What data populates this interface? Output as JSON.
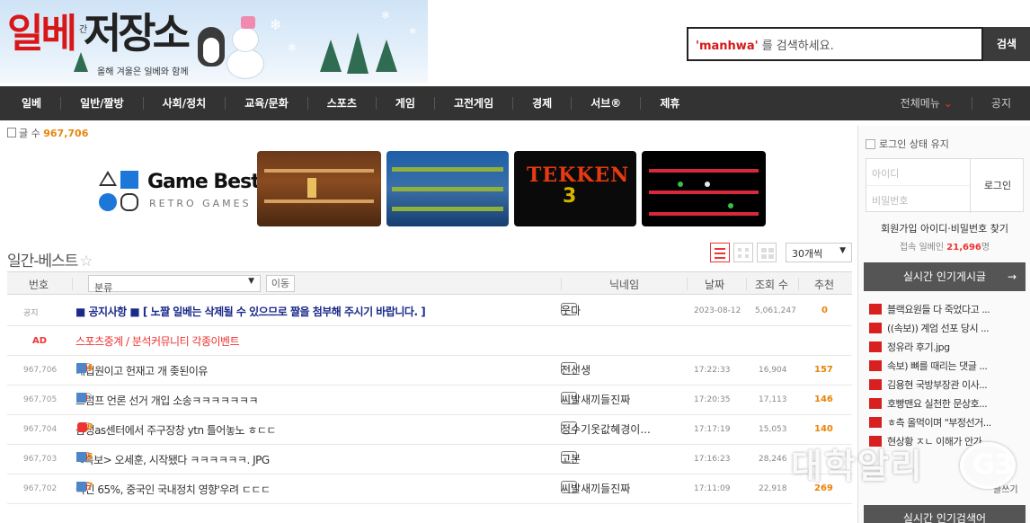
{
  "header": {
    "logo_main": "일베",
    "logo_sub": "간",
    "logo_small": "저장소",
    "tagline": "올해 겨울은 일베와 함께",
    "search_placeholder_keyword": "'manhwa'",
    "search_placeholder_rest": " 를 검색하세요.",
    "search_button": "검색"
  },
  "nav": {
    "items": [
      "일베",
      "일반/짤방",
      "사회/정치",
      "교육/문화",
      "스포츠",
      "게임",
      "고전게임",
      "경제",
      "서브®",
      "제휴"
    ],
    "all_menu": "전체메뉴",
    "notice": "공지"
  },
  "post_count": {
    "label": "글 수",
    "value": "967,706"
  },
  "ad": {
    "title": "Game Best",
    "subtitle": "RETRO GAMES",
    "tekken": "TEKKEN",
    "tekken3": "3"
  },
  "best": {
    "title": "일간-베스트",
    "per_page": "30개씩"
  },
  "table": {
    "headers": {
      "num": "번호",
      "category": "분류",
      "move": "이동",
      "nick": "닉네임",
      "date": "날짜",
      "views": "조회 수",
      "rec": "추천"
    },
    "notice": {
      "num": "공지",
      "subject": "■ 공지사항 ■ [ 노짤 일베는 삭제될 수 있으므로 짤을 첨부해 주시기 바랍니다. ]",
      "nick": "웃다",
      "date": "2023-08-12",
      "views": "5,061,247",
      "rec": "0"
    },
    "ad_row": {
      "num": "AD",
      "subject": "스포츠중계 / 분석커뮤니티 각종이벤트"
    },
    "rows": [
      {
        "num": "967,706",
        "subject": "대법원이고 헌재고 개 좆된이유",
        "comments": "34",
        "nick": "전선생",
        "date": "17:22:33",
        "views": "16,904",
        "rec": "157"
      },
      {
        "num": "967,705",
        "subject": "트럼프 언론 선거 개입 소송ㅋㅋㅋㅋㅋㅋㅋ",
        "comments": "4",
        "nick": "씨발새끼들진짜",
        "date": "17:20:35",
        "views": "17,113",
        "rec": "146"
      },
      {
        "num": "967,704",
        "subject": "삼성as센터에서 주구장창 ytn 틀어놓노 ㅎㄷㄷ",
        "comments": "38",
        "nick": "정수기옷값혜경이...",
        "date": "17:17:19",
        "views": "15,053",
        "rec": "140"
      },
      {
        "num": "967,703",
        "subject": "<속보> 오세훈, 시작됐다 ㅋㅋㅋㅋㅋㅋ. JPG",
        "comments": "85",
        "nick": "고본",
        "date": "17:16:23",
        "views": "28,246",
        "rec": ""
      },
      {
        "num": "967,702",
        "subject": "국민 65%, 중국인 국내정치 영향'우려 ㄷㄷㄷ",
        "comments": "47",
        "nick": "씨발새끼들진짜",
        "date": "17:11:09",
        "views": "22,918",
        "rec": "269"
      }
    ]
  },
  "sidebar": {
    "keep_login": "로그인 상태 유지",
    "id_placeholder": "아이디",
    "pw_placeholder": "비밀번호",
    "login": "로그인",
    "links": "회원가입    아이디·비밀번호 찾기",
    "online_label": "접속 일베인",
    "online_count": "21,696",
    "online_unit": "명",
    "popular_title": "실시간 인기게시글",
    "popular_items": [
      "블랙요원들 다 죽었다고 ...",
      "((속보)) 계엄 선포 당시 ...",
      "정유라 후기.jpg",
      "속보) 뼈를 때리는 댓글 ...",
      "김용현 국방부장관 이사...",
      "호빵맨요 실천한 문상호...",
      "ㅎ측 올먹이며 \"부정선거...",
      "현상황 ㅈㄴ 이해가 안가..."
    ],
    "write": "글쓰기",
    "popular_search_title": "실시간 인기검색어"
  },
  "watermark": "대학알리",
  "watermark_mark": "G3"
}
